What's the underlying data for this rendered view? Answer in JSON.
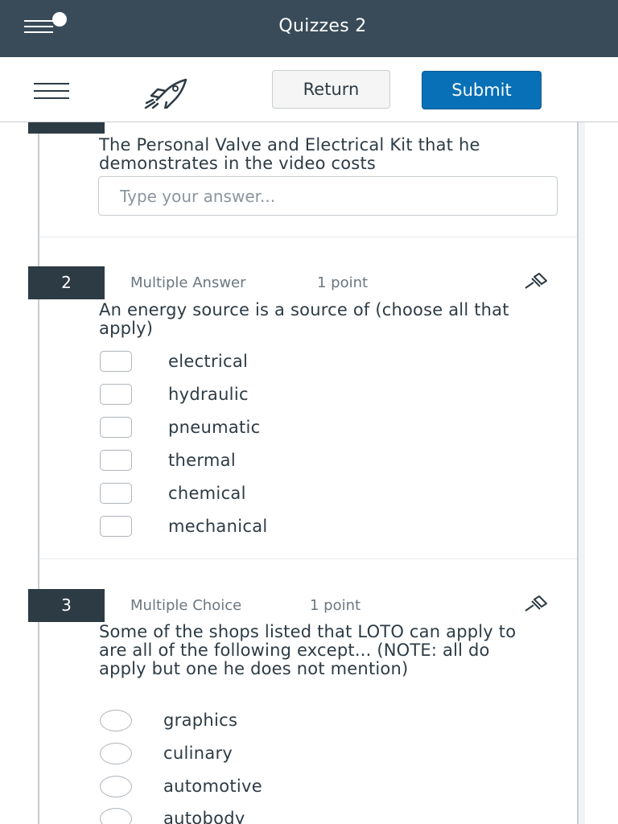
{
  "header": {
    "title": "Quizzes 2"
  },
  "toolbar": {
    "return_label": "Return",
    "submit_label": "Submit"
  },
  "questions": [
    {
      "text": "The Personal Valve and Electrical Kit that he demonstrates in the video costs",
      "input_placeholder": "Type your answer..."
    },
    {
      "number": "2",
      "type": "Multiple Answer",
      "points": "1 point",
      "text": "An energy source is a source of (choose all that apply)",
      "options": [
        "electrical",
        "hydraulic",
        "pneumatic",
        "thermal",
        "chemical",
        "mechanical"
      ]
    },
    {
      "number": "3",
      "type": "Multiple Choice",
      "points": "1 point",
      "text": "Some of the shops listed that LOTO can apply to are all of the following except... (NOTE: all do apply but one he does not mention)",
      "options": [
        "graphics",
        "culinary",
        "automotive",
        "autobody"
      ]
    }
  ],
  "colors": {
    "header_bg": "#394b58",
    "submit_bg": "#0770b7",
    "question_badge_bg": "#2d3b45"
  }
}
